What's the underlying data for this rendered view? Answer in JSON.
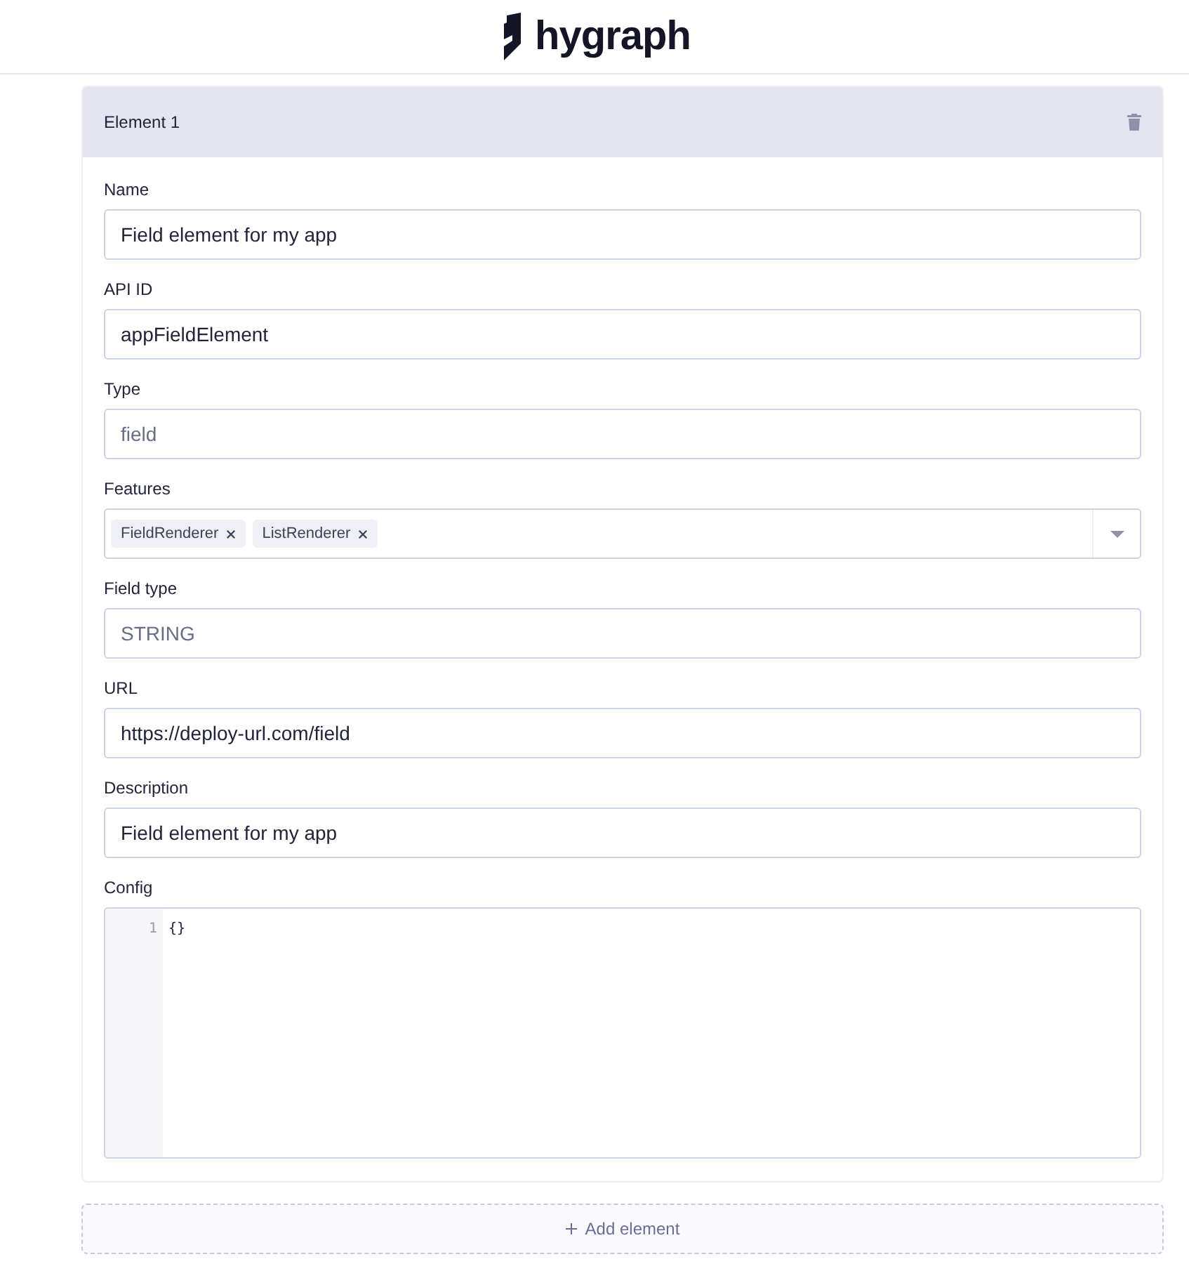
{
  "header": {
    "logo_text": "hygraph"
  },
  "element": {
    "title": "Element 1",
    "fields": [
      {
        "kind": "text",
        "label": "Name",
        "value": "Field element for my app",
        "disabled": false
      },
      {
        "kind": "text",
        "label": "API ID",
        "value": "appFieldElement",
        "disabled": false
      },
      {
        "kind": "text",
        "label": "Type",
        "value": "field",
        "disabled": true
      },
      {
        "kind": "multiselect",
        "label": "Features",
        "tags": [
          "FieldRenderer",
          "ListRenderer"
        ]
      },
      {
        "kind": "text",
        "label": "Field type",
        "value": "STRING",
        "disabled": true
      },
      {
        "kind": "text",
        "label": "URL",
        "value": "https://deploy-url.com/field",
        "disabled": false
      },
      {
        "kind": "text",
        "label": "Description",
        "value": "Field element for my app",
        "disabled": false
      },
      {
        "kind": "code",
        "label": "Config",
        "lines": [
          {
            "number": "1",
            "text": "{}"
          }
        ]
      }
    ]
  },
  "add_button": {
    "label": "Add element"
  }
}
